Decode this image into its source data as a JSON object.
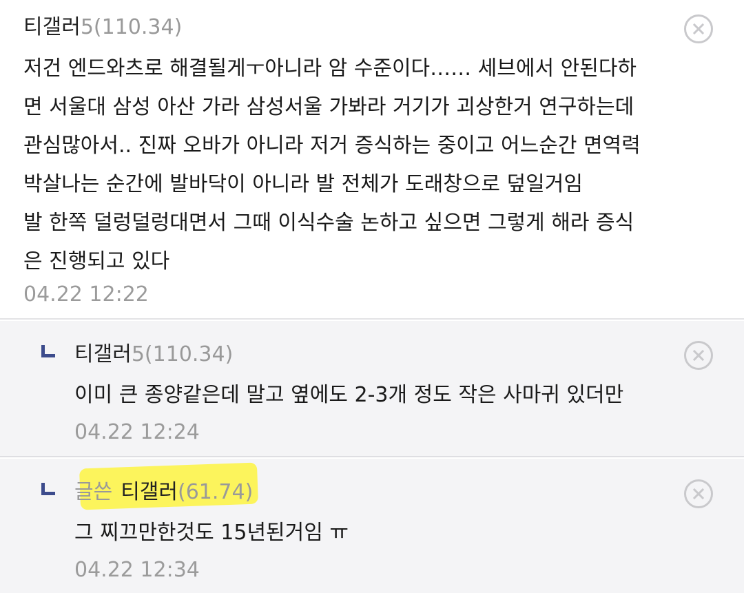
{
  "comments": [
    {
      "nick": "티갤러",
      "level": "5",
      "ip": "(110.34)",
      "lines": [
        "저건 엔드와츠로 해결될게ㅜ아니라 암 수준이다…… 세브에서 안된다하",
        "면 서울대 삼성 아산 가라 삼성서울 가봐라 거기가 괴상한거 연구하는데",
        "관심많아서.. 진짜 오바가 아니라 저거 증식하는 중이고 어느순간 면역력",
        "박살나는 순간에 발바닥이 아니라 발 전체가 도래창으로 덮일거임",
        "발 한쪽 덜렁덜렁대면서 그때 이식수술 논하고 싶으면 그렇게 해라 증식",
        "은 진행되고 있다"
      ],
      "time": "04.22 12:22"
    },
    {
      "nick": "티갤러",
      "level": "5",
      "ip": "(110.34)",
      "lines": [
        "이미 큰 종양같은데 말고 옆에도 2-3개 정도 작은 사마귀 있더만"
      ],
      "time": "04.22 12:24"
    },
    {
      "op_tag": "글쓴",
      "nick": "티갤러",
      "ip": "(61.74)",
      "lines": [
        "그 찌끄만한것도 15년된거임 ㅠ"
      ],
      "time": "04.22 12:34"
    }
  ],
  "icons": {
    "reply": "reply-arrow-icon",
    "delete": "close-icon"
  },
  "colors": {
    "reply_background": "#f4f4f6",
    "reply_marker": "#3c4b8c",
    "highlight": "#fff428",
    "timestamp": "#9b9b9b"
  }
}
